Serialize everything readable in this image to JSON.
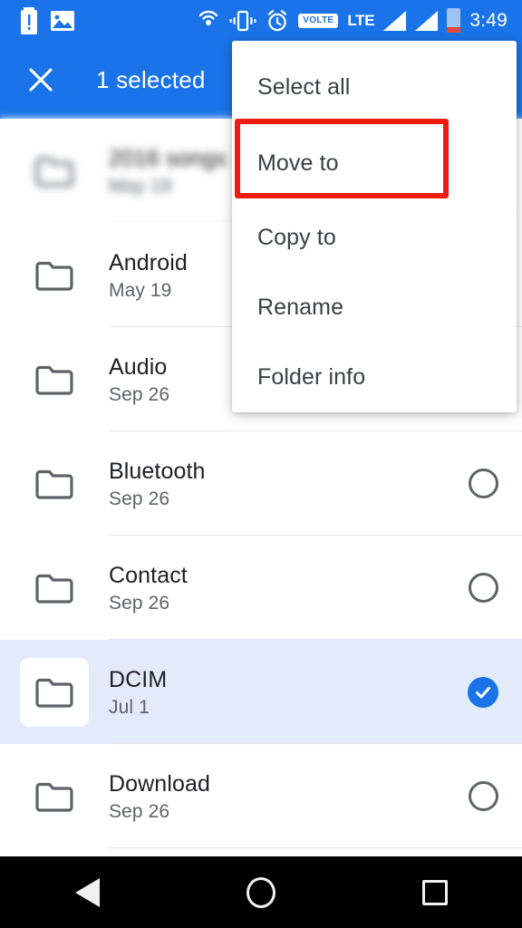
{
  "status_bar": {
    "time": "3:49",
    "network_label": "LTE",
    "volte_label": "VOLTE",
    "left_icons": [
      "battery-alert-icon",
      "photo-icon"
    ],
    "right_icons": [
      "hotspot-icon",
      "vibrate-icon",
      "alarm-icon",
      "volte-badge",
      "lte-label",
      "signal-bars-sim1-icon",
      "signal-bars-sim2-icon",
      "battery-icon"
    ],
    "background_color": "#1a73e8"
  },
  "app_bar": {
    "close_label": "×",
    "title": "1 selected",
    "background_color": "#1a73e8"
  },
  "menu": {
    "items": [
      {
        "label": "Select all",
        "name": "menu-item-select-all",
        "highlighted": false
      },
      {
        "label": "Move to",
        "name": "menu-item-move-to",
        "highlighted": true
      },
      {
        "label": "Copy to",
        "name": "menu-item-copy-to",
        "highlighted": false
      },
      {
        "label": "Rename",
        "name": "menu-item-rename",
        "highlighted": false
      },
      {
        "label": "Folder info",
        "name": "menu-item-folder-info",
        "highlighted": false
      }
    ],
    "highlight_color": "#ee1b11"
  },
  "file_list": {
    "rows": [
      {
        "name": "2016 songs",
        "date": "May 19",
        "selected": false,
        "blurred": true,
        "checkbox": "none"
      },
      {
        "name": "Android",
        "date": "May 19",
        "selected": false,
        "blurred": false,
        "checkbox": "none"
      },
      {
        "name": "Audio",
        "date": "Sep 26",
        "selected": false,
        "blurred": false,
        "checkbox": "none"
      },
      {
        "name": "Bluetooth",
        "date": "Sep 26",
        "selected": false,
        "blurred": false,
        "checkbox": "unchecked"
      },
      {
        "name": "Contact",
        "date": "Sep 26",
        "selected": false,
        "blurred": false,
        "checkbox": "unchecked"
      },
      {
        "name": "DCIM",
        "date": "Jul 1",
        "selected": true,
        "blurred": false,
        "checkbox": "checked"
      },
      {
        "name": "Download",
        "date": "Sep 26",
        "selected": false,
        "blurred": false,
        "checkbox": "unchecked"
      }
    ],
    "selected_row_color": "#e3ebfa",
    "checked_color": "#1a73e8"
  },
  "nav_bar": {
    "buttons": [
      "back-button",
      "home-button",
      "recents-button"
    ],
    "background_color": "#000000"
  }
}
